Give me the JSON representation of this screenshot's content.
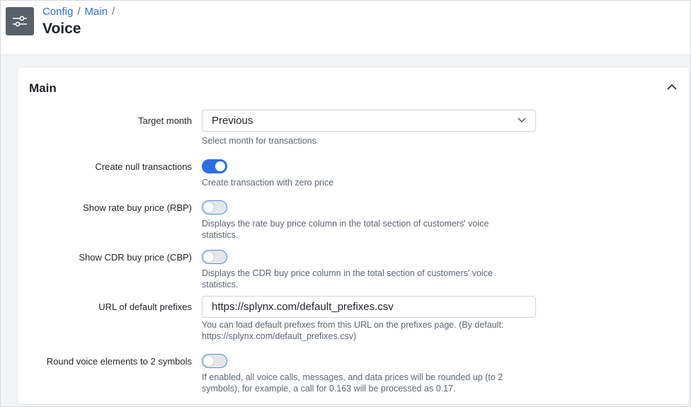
{
  "header": {
    "breadcrumb": [
      "Config",
      "Main"
    ],
    "separator": "/",
    "title": "Voice"
  },
  "section": {
    "title": "Main"
  },
  "fields": {
    "target_month": {
      "label": "Target month",
      "value": "Previous",
      "hint": "Select month for transactions"
    },
    "create_null": {
      "label": "Create null transactions",
      "enabled": true,
      "hint": "Create transaction with zero price"
    },
    "show_rbp": {
      "label": "Show rate buy price (RBP)",
      "enabled": false,
      "hint": "Displays the rate buy price column in the total section of customers' voice statistics."
    },
    "show_cbp": {
      "label": "Show CDR buy price (CBP)",
      "enabled": false,
      "hint": "Displays the CDR buy price column in the total section of customers' voice statistics."
    },
    "url_prefixes": {
      "label": "URL of default prefixes",
      "value": "https://splynx.com/default_prefixes.csv",
      "hint": "You can load default prefixes from this URL on the prefixes page. (By default: https://splynx.com/default_prefixes.csv)"
    },
    "round_voice": {
      "label": "Round voice elements to 2 symbols",
      "enabled": false,
      "hint": "If enabled, all voice calls, messages, and data prices will be rounded up (to 2 symbols), for example, a call for 0.163 will be processed as 0.17."
    }
  },
  "colors": {
    "accent": "#2d6fe0",
    "link": "#2f6fd6",
    "icon_bg": "#5a6068"
  },
  "icons": {
    "app": "sliders-icon",
    "collapse": "chevron-up-icon",
    "select": "chevron-down-icon"
  }
}
